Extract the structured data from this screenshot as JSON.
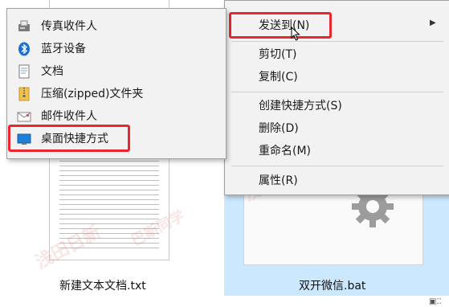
{
  "files": [
    {
      "name": "新建文本文档.txt"
    },
    {
      "name": "双开微信.bat"
    }
  ],
  "status_glyph": "▣⁚⁚",
  "watermark": {
    "text1": "浅田日新",
    "text2": "巴斯同学"
  },
  "context_menu": {
    "items": [
      {
        "label": "发送到(N)",
        "has_submenu": true,
        "highlighted": true
      },
      {
        "label": "剪切(T)"
      },
      {
        "label": "复制(C)"
      },
      {
        "label": "创建快捷方式(S)"
      },
      {
        "label": "删除(D)"
      },
      {
        "label": "重命名(M)"
      },
      {
        "label": "属性(R)"
      }
    ]
  },
  "send_to_menu": {
    "items": [
      {
        "label": "传真收件人",
        "icon": "fax-icon"
      },
      {
        "label": "蓝牙设备",
        "icon": "bluetooth-icon"
      },
      {
        "label": "文档",
        "icon": "documents-icon"
      },
      {
        "label": "压缩(zipped)文件夹",
        "icon": "zip-folder-icon"
      },
      {
        "label": "邮件收件人",
        "icon": "mail-icon"
      },
      {
        "label": "桌面快捷方式",
        "icon": "desktop-icon",
        "highlighted": true
      }
    ]
  },
  "colors": {
    "highlight_border": "#e8282e",
    "selection_bg": "#cce8ff",
    "menu_bg": "#f2f2f2",
    "bluetooth": "#1a6fd1"
  }
}
